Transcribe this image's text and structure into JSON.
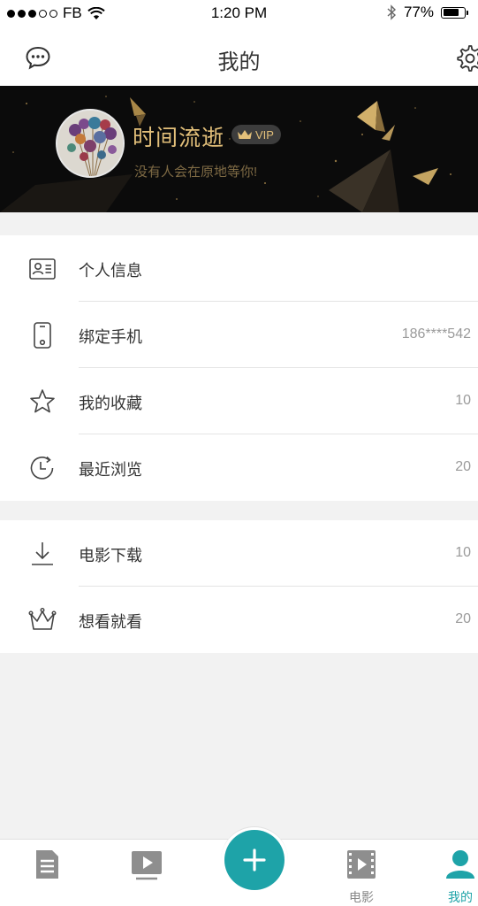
{
  "status_bar": {
    "carrier": "FB",
    "time": "1:20 PM",
    "battery": "77%",
    "battery_level": 0.77
  },
  "nav": {
    "title": "我的"
  },
  "profile": {
    "username": "时间流逝",
    "vip_label": "VIP",
    "motto": "没有人会在原地等你!"
  },
  "section1": [
    {
      "label": "个人信息",
      "value": "",
      "icon": "id-card-icon"
    },
    {
      "label": "绑定手机",
      "value": "186****542",
      "icon": "phone-icon"
    },
    {
      "label": "我的收藏",
      "value": "10",
      "icon": "star-icon"
    },
    {
      "label": "最近浏览",
      "value": "20",
      "icon": "history-clock-icon"
    }
  ],
  "section2": [
    {
      "label": "电影下载",
      "value": "10",
      "icon": "download-icon"
    },
    {
      "label": "想看就看",
      "value": "20",
      "icon": "crown-icon"
    }
  ],
  "tabs": [
    {
      "label": "",
      "icon": "document-icon"
    },
    {
      "label": "",
      "icon": "play-video-icon"
    },
    {
      "label": "电影",
      "icon": "film-icon"
    },
    {
      "label": "我的",
      "icon": "user-icon",
      "active": true
    }
  ],
  "colors": {
    "accent": "#1ea3a8",
    "gold": "#e3c07a"
  }
}
